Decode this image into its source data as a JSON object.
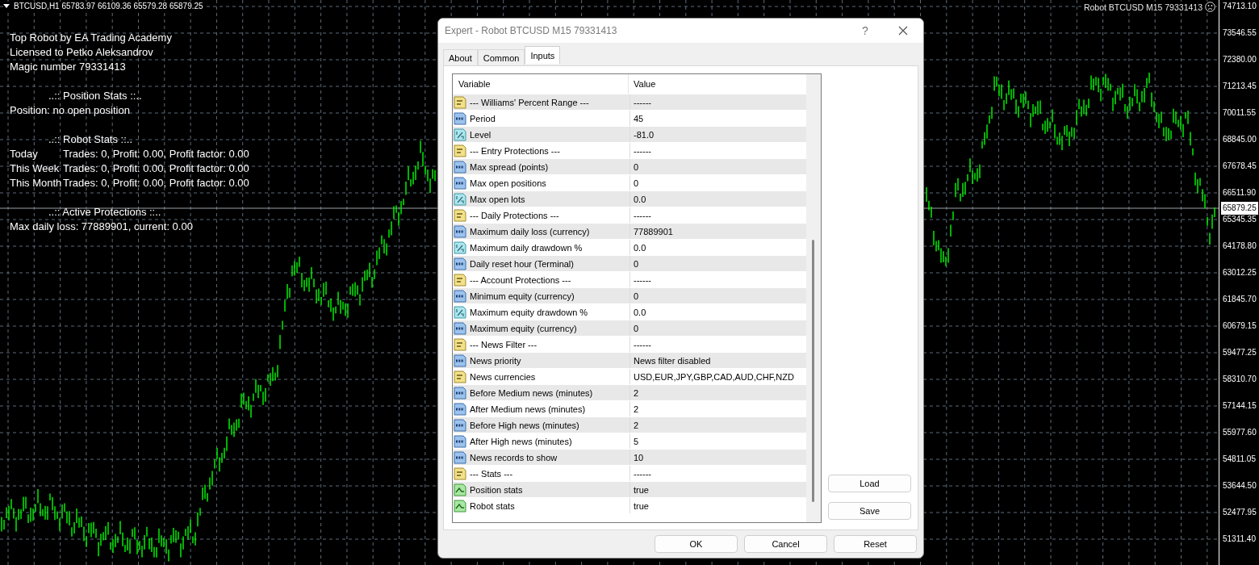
{
  "chart": {
    "symbol_info": "BTCUSD,H1  65783.97 66109.36 65579.28 65879.25",
    "expert_label": "Robot BTCUSD M15 79331413",
    "current_price": "65879.25",
    "price_axis": [
      "74713.10",
      "73546.55",
      "72380.00",
      "71213.45",
      "70011.55",
      "68845.00",
      "67678.45",
      "66511.90",
      "65345.35",
      "64178.80",
      "63012.25",
      "61845.70",
      "60679.15",
      "59477.25",
      "58310.70",
      "57144.15",
      "55977.60",
      "54811.05",
      "53644.50",
      "52477.95",
      "51311.40"
    ]
  },
  "overlay": [
    {
      "lines": [
        {
          "text": "Top Robot by EA Trading Academy"
        },
        {
          "text": "Licensed to Petko Aleksandrov"
        },
        {
          "text": "Magic number 79331413"
        }
      ]
    },
    {
      "heading": "..:: Position Stats ::..",
      "lines": [
        {
          "text": "Position: no open position"
        }
      ]
    },
    {
      "heading": "..:: Robot Stats ::..",
      "lines": [
        {
          "label": "Today",
          "text": "Trades: 0, Profit: 0.00, Profit factor: 0.00"
        },
        {
          "label": "This Week",
          "text": "Trades: 0, Profit: 0.00, Profit factor: 0.00"
        },
        {
          "label": "This Month",
          "text": "Trades: 0, Profit: 0.00, Profit factor: 0.00"
        }
      ]
    },
    {
      "heading": "..:: Active Protections ::..",
      "lines": [
        {
          "text": "Max daily loss: 77889901, current: 0.00"
        }
      ]
    }
  ],
  "dialog": {
    "title": "Expert - Robot BTCUSD M15 79331413",
    "help": "?",
    "tabs": [
      {
        "label": "About",
        "selected": false
      },
      {
        "label": "Common",
        "selected": false
      },
      {
        "label": "Inputs",
        "selected": true
      }
    ],
    "columns": [
      "Variable",
      "Value"
    ],
    "rows": [
      {
        "kind": "string",
        "variable": "--- Williams' Percent Range ---",
        "value": "------"
      },
      {
        "kind": "int",
        "variable": "Period",
        "value": "45"
      },
      {
        "kind": "double",
        "variable": "Level",
        "value": "-81.0"
      },
      {
        "kind": "string",
        "variable": "--- Entry Protections ---",
        "value": "------"
      },
      {
        "kind": "int",
        "variable": "Max spread (points)",
        "value": "0"
      },
      {
        "kind": "int",
        "variable": "Max open positions",
        "value": "0"
      },
      {
        "kind": "double",
        "variable": "Max open lots",
        "value": "0.0"
      },
      {
        "kind": "string",
        "variable": "--- Daily Protections ---",
        "value": "------"
      },
      {
        "kind": "int",
        "variable": "Maximum daily loss (currency)",
        "value": "77889901"
      },
      {
        "kind": "double",
        "variable": "Maximum daily drawdown %",
        "value": "0.0"
      },
      {
        "kind": "int",
        "variable": "Daily reset hour (Terminal)",
        "value": "0"
      },
      {
        "kind": "string",
        "variable": "--- Account Protections ---",
        "value": "------"
      },
      {
        "kind": "int",
        "variable": "Minimum equity (currency)",
        "value": "0"
      },
      {
        "kind": "double",
        "variable": "Maximum equity drawdown %",
        "value": "0.0"
      },
      {
        "kind": "int",
        "variable": "Maximum equity (currency)",
        "value": "0"
      },
      {
        "kind": "string",
        "variable": "--- News Filter ---",
        "value": "------"
      },
      {
        "kind": "int",
        "variable": "News priority",
        "value": "News filter disabled"
      },
      {
        "kind": "string",
        "variable": "News currencies",
        "value": "USD,EUR,JPY,GBP,CAD,AUD,CHF,NZD"
      },
      {
        "kind": "int",
        "variable": "Before Medium news (minutes)",
        "value": "2"
      },
      {
        "kind": "int",
        "variable": "After Medium news (minutes)",
        "value": "2"
      },
      {
        "kind": "int",
        "variable": "Before High news (minutes)",
        "value": "2"
      },
      {
        "kind": "int",
        "variable": "After High news (minutes)",
        "value": "5"
      },
      {
        "kind": "int",
        "variable": "News records to show",
        "value": "10"
      },
      {
        "kind": "string",
        "variable": "--- Stats ---",
        "value": "------"
      },
      {
        "kind": "bool",
        "variable": "Position stats",
        "value": "true"
      },
      {
        "kind": "bool",
        "variable": "Robot stats",
        "value": "true"
      }
    ],
    "side_buttons": [
      "Load",
      "Save"
    ],
    "buttons": [
      "OK",
      "Cancel",
      "Reset"
    ]
  }
}
